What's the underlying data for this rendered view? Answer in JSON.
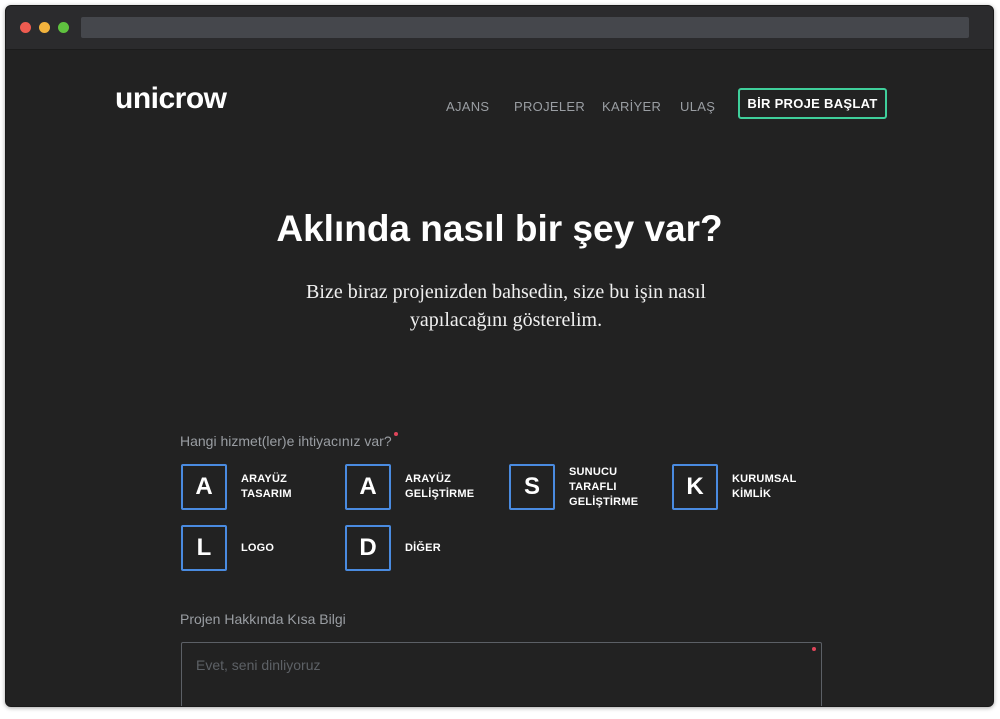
{
  "brand": {
    "logo_text": "unicrow"
  },
  "nav": {
    "items": [
      {
        "label": "AJANS"
      },
      {
        "label": "PROJELER"
      },
      {
        "label": "KARİYER"
      },
      {
        "label": "ULAŞ"
      }
    ],
    "cta_label": "BİR PROJE BAŞLAT"
  },
  "hero": {
    "title": "Aklında nasıl bir şey var?",
    "subtitle_line1": "Bize biraz projenizden bahsedin, size bu işin nasıl",
    "subtitle_line2": "yapılacağını gösterelim."
  },
  "form": {
    "services_label": "Hangi hizmet(ler)e ihtiyacınız var?",
    "services": [
      {
        "letter": "A",
        "line1": "ARAYÜZ",
        "line2": "TASARIM",
        "line3": ""
      },
      {
        "letter": "A",
        "line1": "ARAYÜZ",
        "line2": "GELİŞTİRME",
        "line3": ""
      },
      {
        "letter": "S",
        "line1": "SUNUCU",
        "line2": "TARAFLI",
        "line3": "GELİŞTİRME"
      },
      {
        "letter": "K",
        "line1": "KURUMSAL",
        "line2": "KİMLİK",
        "line3": ""
      },
      {
        "letter": "L",
        "line1": "LOGO",
        "line2": "",
        "line3": ""
      },
      {
        "letter": "D",
        "line1": "DİĞER",
        "line2": "",
        "line3": ""
      }
    ],
    "info_label": "Projen Hakkında Kısa Bilgi",
    "info_placeholder": "Evet, seni dinliyoruz",
    "info_value": ""
  },
  "colors": {
    "background": "#222222",
    "accent_green": "#3fcf9b",
    "accent_blue": "#4a8be0",
    "required_red": "#e0455a"
  }
}
